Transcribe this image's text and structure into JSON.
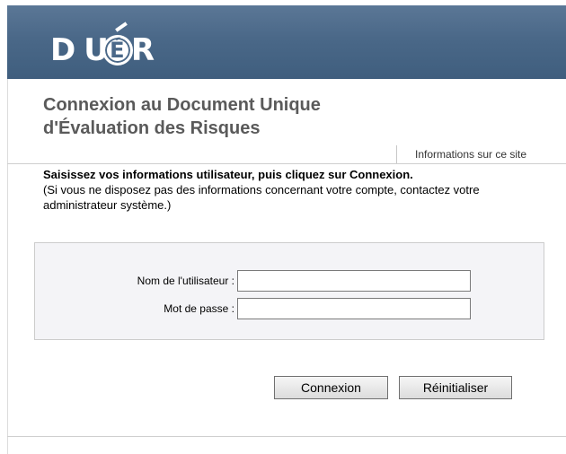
{
  "header": {
    "logo_letters": [
      "D",
      "U",
      "É",
      "R"
    ]
  },
  "page": {
    "title_line1": "Connexion au Document Unique",
    "title_line2": "d'Évaluation des Risques",
    "info_link": "Informations sur ce site"
  },
  "instructions": {
    "main": "Saisissez vos informations utilisateur, puis cliquez sur Connexion.",
    "note": "(Si vous ne disposez pas des informations concernant votre compte, contactez votre administrateur système.)"
  },
  "form": {
    "username_label": "Nom de l'utilisateur :",
    "username_value": "",
    "password_label": "Mot de passe :",
    "password_value": ""
  },
  "buttons": {
    "connect": "Connexion",
    "reset": "Réinitialiser"
  },
  "colors": {
    "header_bg": "#4a6888",
    "title_text": "#5a5a5a",
    "form_bg": "#f4f4f7"
  }
}
